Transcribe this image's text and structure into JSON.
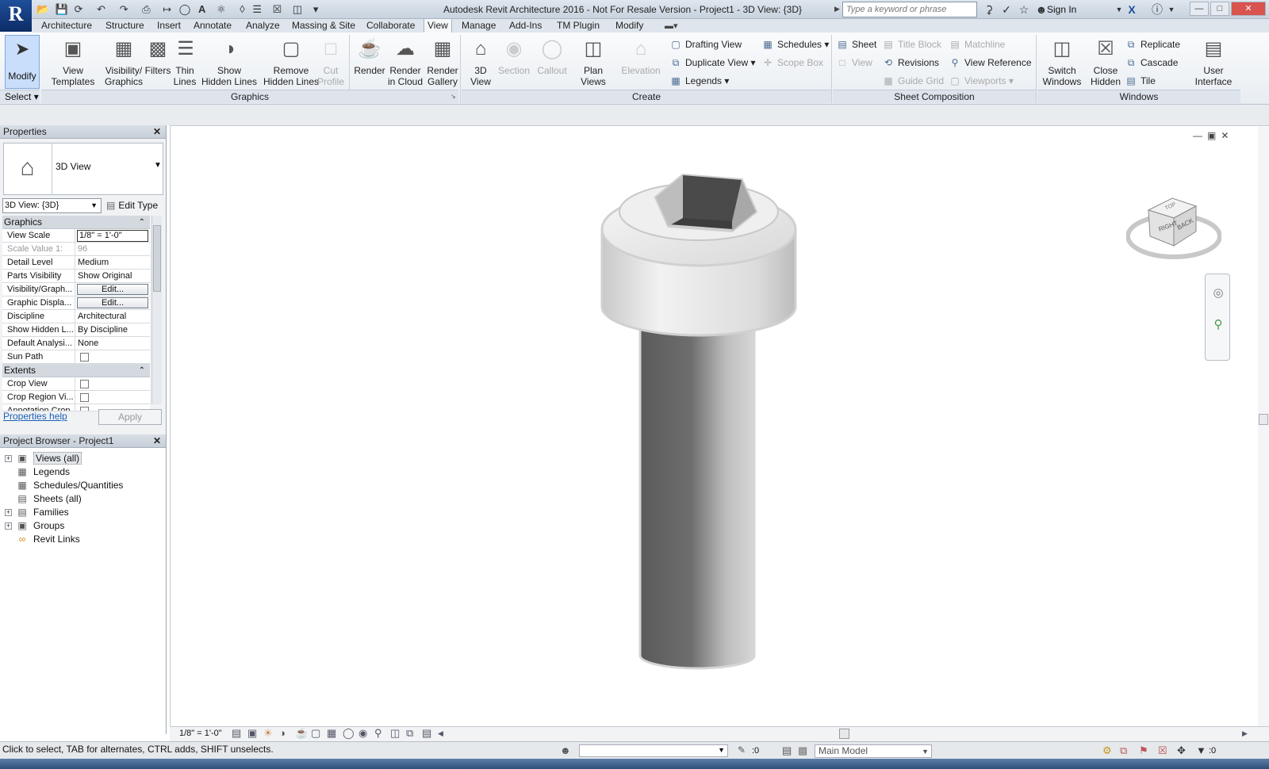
{
  "window": {
    "title": "Autodesk Revit Architecture 2016 - Not For Resale Version -    Project1 - 3D View: {3D}",
    "search_placeholder": "Type a keyword or phrase",
    "sign_in": "Sign In",
    "logo_letter": "R",
    "logo_sub": "A"
  },
  "tabs": [
    "Architecture",
    "Structure",
    "Insert",
    "Annotate",
    "Analyze",
    "Massing & Site",
    "Collaborate",
    "View",
    "Manage",
    "Add-Ins",
    "TM Plugin",
    "Modify"
  ],
  "active_tab": "View",
  "ribbon": {
    "modify": "Modify",
    "select": "Select",
    "graphics": {
      "label": "Graphics",
      "view_templates": [
        "View",
        "Templates"
      ],
      "visibility": [
        "Visibility/",
        "Graphics"
      ],
      "filters": "Filters",
      "thin_lines": [
        "Thin",
        "Lines"
      ],
      "show_hidden": [
        "Show",
        "Hidden Lines"
      ],
      "remove_hidden": [
        "Remove",
        "Hidden Lines"
      ],
      "cut_profile": [
        "Cut",
        "Profile"
      ]
    },
    "presentation": {
      "render": "Render",
      "render_cloud": [
        "Render",
        "in Cloud"
      ],
      "render_gallery": [
        "Render",
        "Gallery"
      ]
    },
    "create": {
      "label": "Create",
      "view3d": [
        "3D",
        "View"
      ],
      "section": "Section",
      "callout": "Callout",
      "plan_views": [
        "Plan",
        "Views"
      ],
      "elevation": "Elevation",
      "drafting_view": "Drafting  View",
      "duplicate_view": "Duplicate  View",
      "legends": "Legends",
      "schedules": "Schedules",
      "scope_box": "Scope  Box"
    },
    "sheet": {
      "label": "Sheet Composition",
      "sheet": "Sheet",
      "view": "View",
      "title_block": "Title  Block",
      "revisions": "Revisions",
      "guide_grid": "Guide  Grid",
      "matchline": "Matchline",
      "view_reference": "View  Reference",
      "viewports": "Viewports"
    },
    "windows": {
      "label": "Windows",
      "switch_windows": [
        "Switch",
        "Windows"
      ],
      "close_hidden": [
        "Close",
        "Hidden"
      ],
      "replicate": "Replicate",
      "cascade": "Cascade",
      "tile": "Tile",
      "user_interface": [
        "User",
        "Interface"
      ]
    }
  },
  "properties": {
    "title": "Properties",
    "type_name": "3D View",
    "view_selector": "3D View: {3D}",
    "edit_type": "Edit Type",
    "groups": [
      {
        "name": "Graphics",
        "rows": [
          {
            "k": "View Scale",
            "v": "1/8\" = 1'-0\"",
            "kind": "edit"
          },
          {
            "k": "Scale Value    1:",
            "v": "96",
            "kind": "dis"
          },
          {
            "k": "Detail Level",
            "v": "Medium",
            "kind": "text"
          },
          {
            "k": "Parts Visibility",
            "v": "Show Original",
            "kind": "text"
          },
          {
            "k": "Visibility/Graph...",
            "v": "Edit...",
            "kind": "btn"
          },
          {
            "k": "Graphic Displa...",
            "v": "Edit...",
            "kind": "btn"
          },
          {
            "k": "Discipline",
            "v": "Architectural",
            "kind": "text"
          },
          {
            "k": "Show Hidden L...",
            "v": "By Discipline",
            "kind": "text"
          },
          {
            "k": "Default Analysi...",
            "v": "None",
            "kind": "text"
          },
          {
            "k": "Sun Path",
            "v": "",
            "kind": "cb"
          }
        ]
      },
      {
        "name": "Extents",
        "rows": [
          {
            "k": "Crop View",
            "v": "",
            "kind": "cb"
          },
          {
            "k": "Crop Region Vi...",
            "v": "",
            "kind": "cb"
          },
          {
            "k": "Annotation Crop",
            "v": "",
            "kind": "cb"
          }
        ]
      }
    ],
    "help": "Properties help",
    "apply": "Apply"
  },
  "project_browser": {
    "title": "Project Browser - Project1",
    "items": [
      {
        "label": "Views (all)",
        "expand": "+",
        "icon": "views-icon",
        "selected": true
      },
      {
        "label": "Legends",
        "expand": "",
        "icon": "legend-icon",
        "selected": false
      },
      {
        "label": "Schedules/Quantities",
        "expand": "",
        "icon": "schedule-icon",
        "selected": false
      },
      {
        "label": "Sheets (all)",
        "expand": "",
        "icon": "sheet-icon",
        "selected": false
      },
      {
        "label": "Families",
        "expand": "+",
        "icon": "family-icon",
        "selected": false
      },
      {
        "label": "Groups",
        "expand": "+",
        "icon": "group-icon",
        "selected": false
      },
      {
        "label": "Revit Links",
        "expand": "",
        "icon": "link-icon",
        "selected": false
      }
    ]
  },
  "viewcube": {
    "right": "RIGHT",
    "back": "BACK",
    "top": "TOP"
  },
  "view_status": {
    "scale": "1/8\" = 1'-0\""
  },
  "status": {
    "hint": "Click to select, TAB for alternates, CTRL adds, SHIFT unselects.",
    "count1": ":0",
    "model": "Main Model",
    "filter_count": ":0"
  },
  "colors": {
    "accent": "#1f4f9a",
    "ribbon_bg": "#eef2f6",
    "selection": "#c9defa"
  }
}
